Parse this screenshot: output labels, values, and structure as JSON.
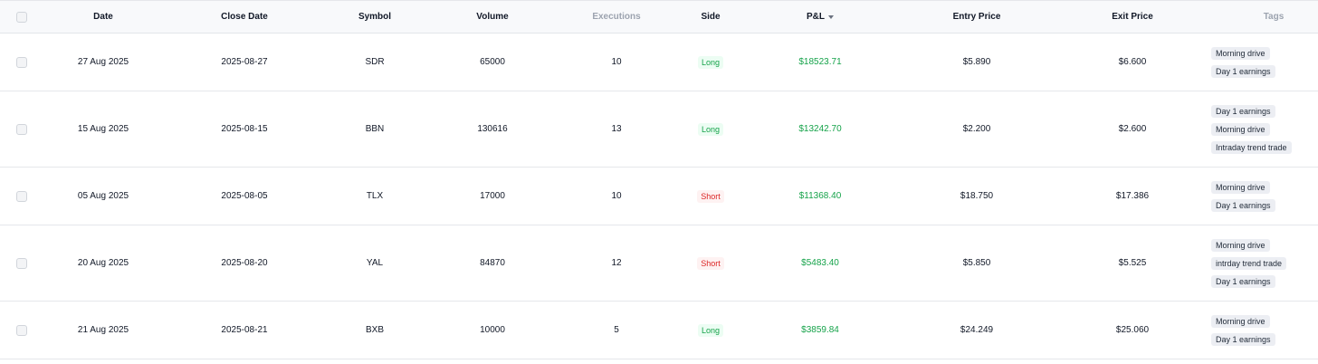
{
  "columns": {
    "date": "Date",
    "close_date": "Close Date",
    "symbol": "Symbol",
    "volume": "Volume",
    "executions": "Executions",
    "side": "Side",
    "pnl": "P&L",
    "entry_price": "Entry Price",
    "exit_price": "Exit Price",
    "tags": "Tags"
  },
  "colors": {
    "profit": "#16a34a",
    "long": "#16a34a",
    "short": "#dc2626",
    "header_bg": "#f8f9fb",
    "tag_bg": "#eceef3"
  },
  "sort": {
    "column": "pnl",
    "direction": "descending",
    "icon": "sort-down-icon"
  },
  "rows": [
    {
      "date": "27 Aug 2025",
      "close_date": "2025-08-27",
      "symbol": "SDR",
      "volume": "65000",
      "executions": "10",
      "side": "Long",
      "pnl": "$18523.71",
      "entry_price": "$5.890",
      "exit_price": "$6.600",
      "tags": [
        "Morning drive",
        "Day 1 earnings"
      ]
    },
    {
      "date": "15 Aug 2025",
      "close_date": "2025-08-15",
      "symbol": "BBN",
      "volume": "130616",
      "executions": "13",
      "side": "Long",
      "pnl": "$13242.70",
      "entry_price": "$2.200",
      "exit_price": "$2.600",
      "tags": [
        "Day 1 earnings",
        "Morning drive",
        "Intraday trend trade"
      ]
    },
    {
      "date": "05 Aug 2025",
      "close_date": "2025-08-05",
      "symbol": "TLX",
      "volume": "17000",
      "executions": "10",
      "side": "Short",
      "pnl": "$11368.40",
      "entry_price": "$18.750",
      "exit_price": "$17.386",
      "tags": [
        "Morning drive",
        "Day 1 earnings"
      ]
    },
    {
      "date": "20 Aug 2025",
      "close_date": "2025-08-20",
      "symbol": "YAL",
      "volume": "84870",
      "executions": "12",
      "side": "Short",
      "pnl": "$5483.40",
      "entry_price": "$5.850",
      "exit_price": "$5.525",
      "tags": [
        "Morning drive",
        "intrday trend trade",
        "Day 1 earnings"
      ]
    },
    {
      "date": "21 Aug 2025",
      "close_date": "2025-08-21",
      "symbol": "BXB",
      "volume": "10000",
      "executions": "5",
      "side": "Long",
      "pnl": "$3859.84",
      "entry_price": "$24.249",
      "exit_price": "$25.060",
      "tags": [
        "Morning drive",
        "Day 1 earnings"
      ]
    }
  ]
}
